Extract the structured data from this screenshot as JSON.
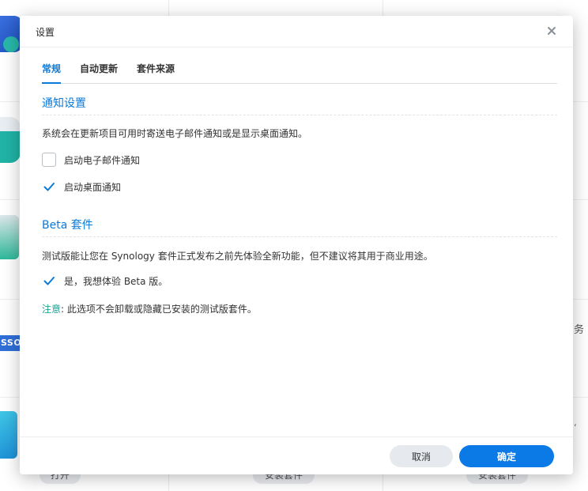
{
  "dialog": {
    "title": "设置",
    "close_icon": "close-icon"
  },
  "tabs": [
    {
      "label": "常规",
      "active": true
    },
    {
      "label": "自动更新",
      "active": false
    },
    {
      "label": "套件来源",
      "active": false
    }
  ],
  "notification": {
    "title": "通知设置",
    "description": "系统会在更新项目可用时寄送电子邮件通知或是显示桌面通知。",
    "options": [
      {
        "label": "启动电子邮件通知",
        "checked": false
      },
      {
        "label": "启动桌面通知",
        "checked": true
      }
    ]
  },
  "beta": {
    "title": "Beta 套件",
    "description": "测试版能让您在 Synology 套件正式发布之前先体验全新功能，但不建议将其用于商业用途。",
    "option": {
      "label": "是，我想体验 Beta 版。",
      "checked": true
    },
    "note_key": "注意",
    "note_text": ": 此选项不会卸载或隐藏已安装的测试版套件。"
  },
  "footer": {
    "cancel_label": "取消",
    "ok_label": "确定"
  },
  "background": {
    "sso_label": "SSO",
    "buttons": [
      "打开",
      "安装套件",
      "安装套件"
    ],
    "side_text": "务",
    "side_mark": "ʻ"
  },
  "colors": {
    "accent": "#0a7ad8",
    "note": "#1aa28e",
    "primary_button": "#0b79e6"
  }
}
